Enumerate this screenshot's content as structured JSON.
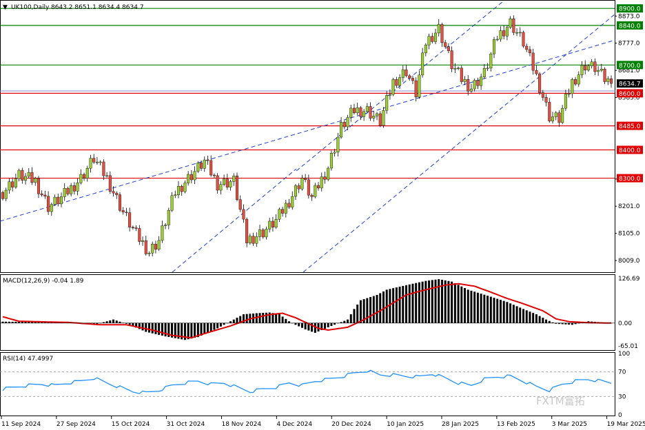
{
  "chart_data": {
    "type": "candlestick",
    "symbol": "UK100,Daily",
    "ohlc_header": "8643.2 8651.1 8634.4 8634.7",
    "last_price": "8634.7",
    "price_axis_ticks": [
      "8873.0",
      "8777.0",
      "8681.0",
      "8585.0",
      "8297.0",
      "8201.0",
      "8105.0",
      "8009.0"
    ],
    "levels": [
      {
        "label": "8900.0",
        "value": 8900,
        "color": "#008000"
      },
      {
        "label": "8840.0",
        "value": 8840,
        "color": "#008000"
      },
      {
        "label": "8700.0",
        "value": 8700,
        "color": "#008000"
      },
      {
        "label": "8600.0",
        "value": 8600,
        "color": "#e00000"
      },
      {
        "label": "8485.0",
        "value": 8485,
        "color": "#e00000"
      },
      {
        "label": "8400.0",
        "value": 8400,
        "color": "#e00000"
      },
      {
        "label": "8300.0",
        "value": 8300,
        "color": "#e00000"
      }
    ],
    "x_labels": [
      "11 Sep 2024",
      "27 Sep 2024",
      "15 Oct 2024",
      "31 Oct 2024",
      "18 Nov 2024",
      "4 Dec 2024",
      "20 Dec 2024",
      "10 Jan 2025",
      "28 Jan 2025",
      "13 Feb 2025",
      "3 Mar 2025",
      "19 Mar 2025"
    ],
    "close_path": [
      [
        0,
        8250
      ],
      [
        5,
        8310
      ],
      [
        10,
        8290
      ],
      [
        14,
        8200
      ],
      [
        18,
        8230
      ],
      [
        24,
        8300
      ],
      [
        28,
        8370
      ],
      [
        32,
        8300
      ],
      [
        37,
        8180
      ],
      [
        41,
        8100
      ],
      [
        45,
        8040
      ],
      [
        48,
        8080
      ],
      [
        53,
        8250
      ],
      [
        57,
        8300
      ],
      [
        62,
        8360
      ],
      [
        66,
        8280
      ],
      [
        71,
        8290
      ],
      [
        75,
        8080
      ],
      [
        80,
        8110
      ],
      [
        84,
        8150
      ],
      [
        88,
        8220
      ],
      [
        92,
        8300
      ],
      [
        95,
        8230
      ],
      [
        100,
        8340
      ],
      [
        104,
        8480
      ],
      [
        108,
        8540
      ],
      [
        112,
        8540
      ],
      [
        116,
        8500
      ],
      [
        120,
        8640
      ],
      [
        124,
        8680
      ],
      [
        127,
        8600
      ],
      [
        130,
        8780
      ],
      [
        134,
        8830
      ],
      [
        138,
        8700
      ],
      [
        141,
        8650
      ],
      [
        144,
        8620
      ],
      [
        148,
        8670
      ],
      [
        152,
        8800
      ],
      [
        156,
        8850
      ],
      [
        160,
        8780
      ],
      [
        164,
        8660
      ],
      [
        168,
        8520
      ],
      [
        171,
        8510
      ],
      [
        175,
        8640
      ],
      [
        179,
        8700
      ],
      [
        182,
        8690
      ],
      [
        185,
        8650
      ],
      [
        187,
        8635
      ]
    ],
    "macd": {
      "label": "MACD(12,26,9) -0.04 1.89",
      "ticks": [
        "126.69",
        "0.00",
        "-65.01"
      ],
      "hist_path": [
        [
          0,
          4
        ],
        [
          10,
          3
        ],
        [
          20,
          2
        ],
        [
          28,
          -5
        ],
        [
          34,
          10
        ],
        [
          39,
          -5
        ],
        [
          44,
          -25
        ],
        [
          50,
          -38
        ],
        [
          56,
          -48
        ],
        [
          60,
          -40
        ],
        [
          66,
          -15
        ],
        [
          70,
          5
        ],
        [
          74,
          25
        ],
        [
          78,
          28
        ],
        [
          82,
          30
        ],
        [
          85,
          25
        ],
        [
          88,
          5
        ],
        [
          90,
          -5
        ],
        [
          93,
          -18
        ],
        [
          96,
          -28
        ],
        [
          100,
          -12
        ],
        [
          106,
          10
        ],
        [
          108,
          40
        ],
        [
          110,
          65
        ],
        [
          115,
          80
        ],
        [
          118,
          95
        ],
        [
          125,
          110
        ],
        [
          130,
          120
        ],
        [
          134,
          125
        ],
        [
          138,
          118
        ],
        [
          143,
          95
        ],
        [
          150,
          75
        ],
        [
          155,
          60
        ],
        [
          160,
          40
        ],
        [
          164,
          25
        ],
        [
          167,
          10
        ],
        [
          170,
          -2
        ],
        [
          175,
          -5
        ],
        [
          180,
          5
        ],
        [
          184,
          2
        ],
        [
          187,
          -1
        ]
      ],
      "signal_path": [
        [
          0,
          18
        ],
        [
          5,
          5
        ],
        [
          20,
          2
        ],
        [
          30,
          -5
        ],
        [
          38,
          -5
        ],
        [
          46,
          -20
        ],
        [
          52,
          -35
        ],
        [
          58,
          -42
        ],
        [
          62,
          -30
        ],
        [
          70,
          -8
        ],
        [
          76,
          12
        ],
        [
          82,
          24
        ],
        [
          86,
          28
        ],
        [
          90,
          15
        ],
        [
          94,
          -2
        ],
        [
          97,
          -15
        ],
        [
          100,
          -20
        ],
        [
          106,
          -12
        ],
        [
          110,
          5
        ],
        [
          116,
          35
        ],
        [
          124,
          80
        ],
        [
          130,
          95
        ],
        [
          136,
          108
        ],
        [
          140,
          112
        ],
        [
          145,
          105
        ],
        [
          150,
          88
        ],
        [
          155,
          70
        ],
        [
          160,
          55
        ],
        [
          166,
          35
        ],
        [
          170,
          12
        ],
        [
          174,
          4
        ],
        [
          180,
          1
        ],
        [
          186,
          0
        ]
      ]
    },
    "rsi": {
      "label": "RSI(14) 47.4997",
      "ticks": [
        "100",
        "70",
        "30",
        "0"
      ],
      "path": [
        [
          0,
          42
        ],
        [
          6,
          47
        ],
        [
          12,
          50
        ],
        [
          16,
          48
        ],
        [
          20,
          52
        ],
        [
          24,
          55
        ],
        [
          28,
          60
        ],
        [
          32,
          52
        ],
        [
          36,
          45
        ],
        [
          40,
          38
        ],
        [
          44,
          36
        ],
        [
          48,
          40
        ],
        [
          52,
          48
        ],
        [
          56,
          52
        ],
        [
          60,
          55
        ],
        [
          64,
          50
        ],
        [
          68,
          52
        ],
        [
          72,
          45
        ],
        [
          76,
          38
        ],
        [
          80,
          42
        ],
        [
          84,
          45
        ],
        [
          88,
          52
        ],
        [
          92,
          48
        ],
        [
          96,
          55
        ],
        [
          100,
          58
        ],
        [
          104,
          62
        ],
        [
          108,
          68
        ],
        [
          112,
          72
        ],
        [
          116,
          65
        ],
        [
          120,
          65
        ],
        [
          124,
          63
        ],
        [
          128,
          62
        ],
        [
          132,
          67
        ],
        [
          136,
          60
        ],
        [
          140,
          52
        ],
        [
          144,
          48
        ],
        [
          148,
          58
        ],
        [
          152,
          62
        ],
        [
          156,
          63
        ],
        [
          160,
          55
        ],
        [
          164,
          46
        ],
        [
          168,
          40
        ],
        [
          172,
          50
        ],
        [
          176,
          55
        ],
        [
          180,
          58
        ],
        [
          184,
          55
        ],
        [
          187,
          52
        ]
      ]
    },
    "watermark": "FXTM富拓"
  }
}
